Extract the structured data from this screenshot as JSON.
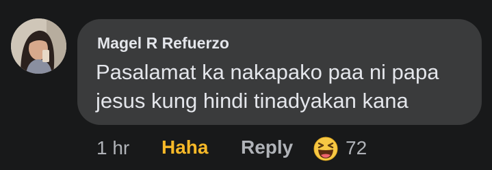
{
  "comment": {
    "author": "Magel R Refuerzo",
    "text": "Pasalamat ka nakapako paa ni papa jesus kung hindi tinadyakan kana"
  },
  "actions": {
    "timestamp": "1 hr",
    "reaction_label": "Haha",
    "reply_label": "Reply",
    "reaction_icon": "haha-emoji-icon",
    "reaction_count": "72"
  },
  "colors": {
    "background": "#18191a",
    "bubble": "#3a3b3c",
    "text": "#e4e6eb",
    "secondary_text": "#b0b3b8",
    "haha_accent": "#f7b928"
  }
}
